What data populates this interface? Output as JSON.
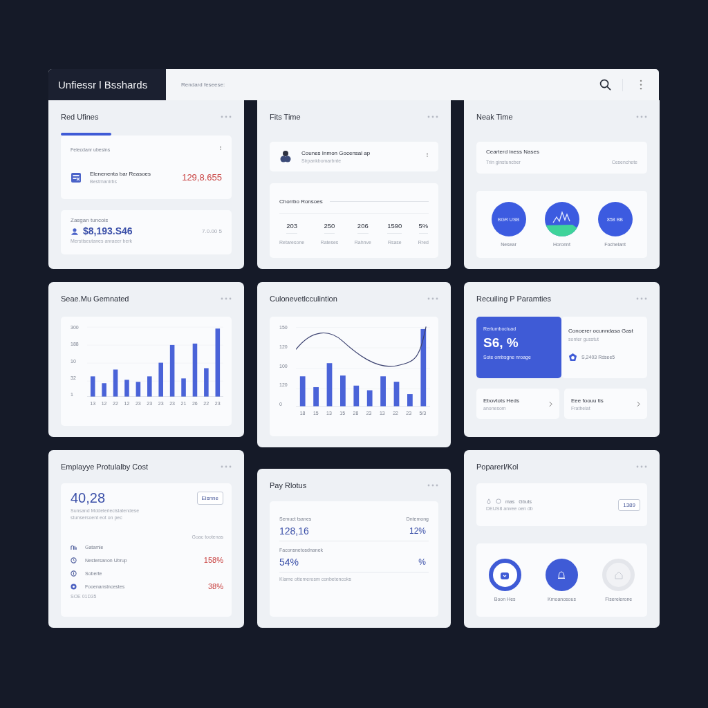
{
  "header": {
    "logo": "Unfiessr l Bsshards",
    "search": {
      "placeholder": "Rendard feseese:"
    }
  },
  "rows": [
    [
      {
        "kind": "summary",
        "title": "Red Ufines",
        "panel_label": "Felecdanr ubesins",
        "item": {
          "title": "Elenenenta bar Reasoes",
          "subtitle": "Bestmanirbs",
          "value": "129,8.655"
        },
        "balance": {
          "label": "Zasgan tuncois",
          "value": "$8,193.S46",
          "side": "7.0.00 5",
          "note": "Merstiseutanes anraeer berk"
        }
      },
      {
        "kind": "contact",
        "title": "Fits Time",
        "contact": {
          "name": "Counes Inmon Gocensal ap",
          "subtitle": "Sirpankbomarbnte"
        },
        "stats_title": "Chorrbo Ronsoes",
        "stats": [
          {
            "value": "203",
            "label": "Retaresone"
          },
          {
            "value": "250",
            "label": "Rateses"
          },
          {
            "value": "206",
            "label": "Rahnve"
          },
          {
            "value": "1590",
            "label": "Rsase"
          },
          {
            "value": "5%",
            "label": "Rred"
          }
        ]
      },
      {
        "kind": "circles",
        "title": "Neak Time",
        "info": {
          "title": "Cearterd iness Nases",
          "subtitle": "Trin ginstuncber",
          "side": "Cesenchete"
        },
        "circles": [
          {
            "kind": "text",
            "text": "BGR USB",
            "label": "Nesear"
          },
          {
            "kind": "wave",
            "label": "Horonnt"
          },
          {
            "kind": "text",
            "text": "858 BB",
            "label": "Fochelant"
          }
        ]
      }
    ],
    [
      {
        "kind": "bars",
        "title": "Seae.Mu Gemnated",
        "y_labels": [
          "300",
          "188",
          "10",
          "32",
          "1"
        ],
        "x_labels": [
          "13",
          "12",
          "22",
          "12",
          "23",
          "23",
          "23",
          "23",
          "21",
          "26",
          "22",
          "23"
        ]
      },
      {
        "kind": "combo",
        "title": "Culonevetlcculintion",
        "y_labels": [
          "150",
          "120",
          "100",
          "120",
          "0"
        ],
        "x_labels": [
          "18",
          "15",
          "13",
          "15",
          "28",
          "23",
          "13",
          "22",
          "23",
          "5/3"
        ]
      },
      {
        "kind": "params",
        "title": "Recuiling P Paramties",
        "highlight": {
          "label": "Rerlumbociuad",
          "value": "S6, %",
          "note": "Sote ombsgne nroage"
        },
        "side": {
          "title": "Conoerer ocunndasa Gast",
          "subtitle": "sonter gusstut",
          "value": "S,2403 Rdsee5"
        },
        "links": [
          {
            "title": "Ebovtots Heds",
            "subtitle": "anonesom"
          },
          {
            "title": "Eee foouu tis",
            "subtitle": "Frathelat"
          }
        ]
      }
    ],
    [
      {
        "kind": "employee",
        "title": "Emplayye Protulalby Cost",
        "value": "40,28",
        "lines": [
          "Sunsand Mddelerlecislatendese",
          "stunsersoent eot on pec"
        ],
        "button": "Eisnne",
        "column": "Goac tootenas",
        "rows": [
          {
            "label": "Gatamle"
          },
          {
            "label": "Nestersanon Ubrup",
            "value": "158%"
          },
          {
            "label": "Soberte"
          },
          {
            "label": "Fooenanstncestes",
            "value": "38%"
          }
        ],
        "footer": "SOE 01D35"
      },
      {
        "kind": "pay",
        "title": "Pay Rlotus",
        "head_left": "Semuct tsanes",
        "head_right": "Dntemong",
        "rows": [
          {
            "label": "",
            "value": "128,16",
            "side": "12%"
          },
          {
            "label": "Faconsnetosdnanek",
            "value": "54%",
            "side": "%"
          }
        ],
        "note": "Klame ottemerosm conbetencoks"
      },
      {
        "kind": "actions",
        "title": "Poparerl/Kol",
        "info": {
          "items": [
            "mas",
            "Gbuts"
          ],
          "subtitle": "DEUS8 anvee oen db",
          "button": "1389"
        },
        "buttons": [
          {
            "kind": "ring",
            "label": "Boon Hes",
            "disabled": false
          },
          {
            "kind": "filled",
            "label": "Kmoanosous",
            "disabled": false
          },
          {
            "kind": "ring",
            "label": "Fiserelerone",
            "disabled": true
          }
        ]
      }
    ]
  ]
}
